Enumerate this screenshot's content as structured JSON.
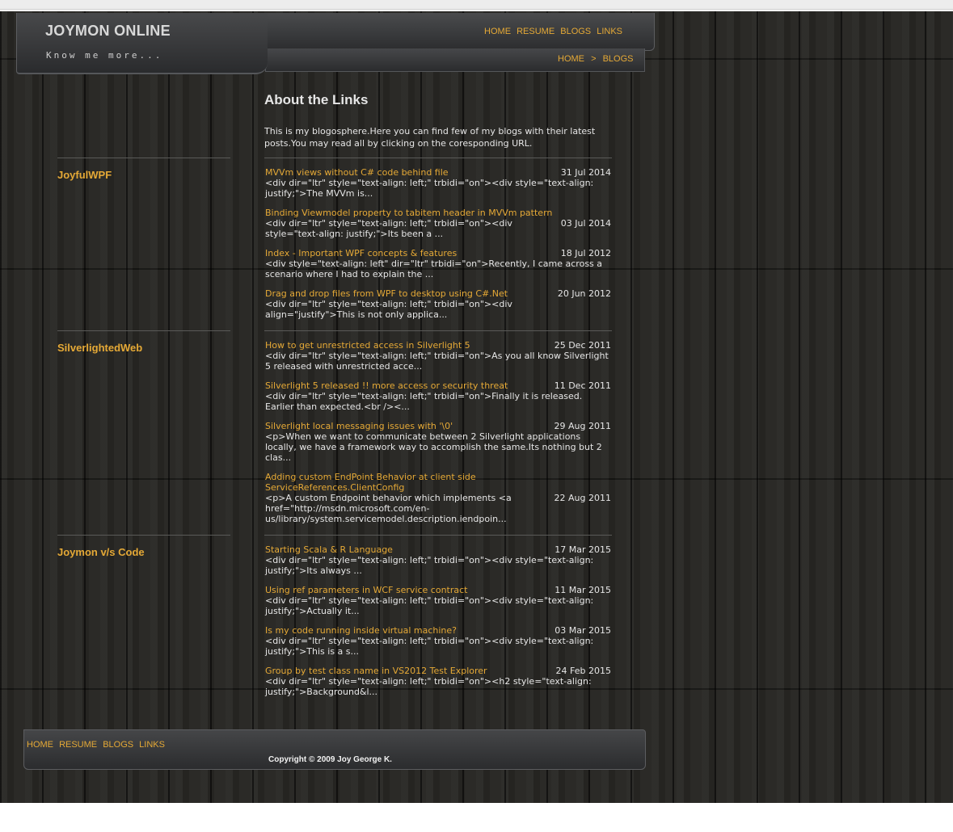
{
  "site": {
    "title": "JOYMON ONLINE",
    "tagline": "Know me more...",
    "nav": [
      "HOME",
      "RESUME",
      "BLOGS",
      "LINKS"
    ],
    "breadcrumb": {
      "home": "HOME",
      "separator": ">",
      "current": "BLOGS"
    }
  },
  "main": {
    "heading": "About the Links",
    "intro": "This is my blogosphere.Here you can find few of my blogs with their latest posts.You may read all by clicking on the coresponding URL."
  },
  "sections": [
    {
      "name": "JoyfulWPF",
      "posts": [
        {
          "title": "MVVm views without C# code behind file",
          "date": "31 Jul 2014",
          "excerpt": "<div dir=\"ltr\" style=\"text-align: left;\" trbidi=\"on\"><div style=\"text-align: justify;\">The MVVm is..."
        },
        {
          "title": "Binding Viewmodel property to tabitem header in MVVm pattern",
          "date": "03 Jul 2014",
          "excerpt": "<div dir=\"ltr\" style=\"text-align: left;\" trbidi=\"on\"><div style=\"text-align: justify;\">Its been a ..."
        },
        {
          "title": "Index - Important WPF concepts & features",
          "date": "18 Jul 2012",
          "excerpt": "<div style=\"text-align: left\" dir=\"ltr\" trbidi=\"on\">Recently, I came across a scenario where I had to explain the ..."
        },
        {
          "title": "Drag and drop files from WPF to desktop using C#.Net",
          "date": "20 Jun 2012",
          "excerpt": "<div dir=\"ltr\" style=\"text-align: left;\" trbidi=\"on\"><div align=\"justify\">This is not only applica..."
        }
      ]
    },
    {
      "name": "SilverlightedWeb",
      "posts": [
        {
          "title": "How to get unrestricted access in Silverlight 5",
          "date": "25 Dec 2011",
          "excerpt": "<div dir=\"ltr\" style=\"text-align: left;\" trbidi=\"on\">As you all know Silverlight 5 released with unrestricted acce..."
        },
        {
          "title": "Silverlight 5 released !! more access or security threat",
          "date": "11 Dec 2011",
          "excerpt": "<div dir=\"ltr\" style=\"text-align: left;\" trbidi=\"on\">Finally it is released. Earlier than expected.<br /><..."
        },
        {
          "title": "Silverlight local messaging issues with '\\0'",
          "date": "29 Aug 2011",
          "excerpt": "<p>When we want to communicate between 2 Silverlight applications locally, we have a framework way to accomplish the same.Its nothing but 2 clas..."
        },
        {
          "title": "Adding custom EndPoint Behavior at client side ServiceReferences.ClientConfig",
          "date": "22 Aug 2011",
          "excerpt": "<p>A custom Endpoint behavior which implements <a href=\"http://msdn.microsoft.com/en-us/library/system.servicemodel.description.iendpoin..."
        }
      ]
    },
    {
      "name": "Joymon v/s Code",
      "posts": [
        {
          "title": "Starting Scala & R Language",
          "date": "17 Mar 2015",
          "excerpt": "<div dir=\"ltr\" style=\"text-align: left;\" trbidi=\"on\"><div style=\"text-align: justify;\">Its always ..."
        },
        {
          "title": "Using ref parameters in WCF service contract",
          "date": "11 Mar 2015",
          "excerpt": "<div dir=\"ltr\" style=\"text-align: left;\" trbidi=\"on\"><div style=\"text-align: justify;\">Actually it..."
        },
        {
          "title": "Is my code running inside virtual machine?",
          "date": "03 Mar 2015",
          "excerpt": "<div dir=\"ltr\" style=\"text-align: left;\" trbidi=\"on\"><div style=\"text-align: justify;\">This is a s..."
        },
        {
          "title": "Group by test class name in VS2012 Test Explorer",
          "date": "24 Feb 2015",
          "excerpt": "<div dir=\"ltr\" style=\"text-align: left;\" trbidi=\"on\"><h2 style=\"text-align: justify;\">Background&l..."
        }
      ]
    }
  ],
  "footer": {
    "nav": [
      "HOME",
      "RESUME",
      "BLOGS",
      "LINKS"
    ],
    "copyright": "Copyright © 2009 Joy George K."
  },
  "colors": {
    "accent": "#e5a936",
    "text": "#e6e6e6",
    "background": "#272623"
  }
}
